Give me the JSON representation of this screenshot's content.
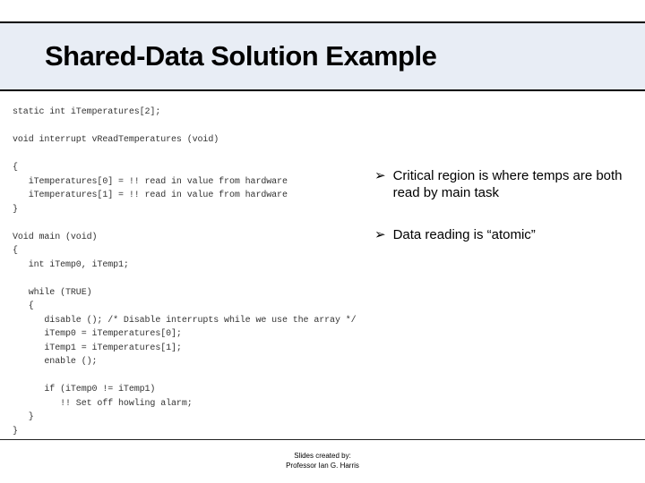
{
  "header": {
    "title": "Shared-Data Solution Example"
  },
  "code": {
    "lines": "static int iTemperatures[2];\n\nvoid interrupt vReadTemperatures (void)\n\n{\n   iTemperatures[0] = !! read in value from hardware\n   iTemperatures[1] = !! read in value from hardware\n}\n\nVoid main (void)\n{\n   int iTemp0, iTemp1;\n\n   while (TRUE)\n   {\n      disable (); /* Disable interrupts while we use the array */\n      iTemp0 = iTemperatures[0];\n      iTemp1 = iTemperatures[1];\n      enable ();\n\n      if (iTemp0 != iTemp1)\n         !! Set off howling alarm;\n   }\n}"
  },
  "bullets": {
    "items": [
      {
        "text": "Critical region is where temps are both read by main task"
      },
      {
        "text": "Data reading is “atomic”"
      }
    ],
    "marker": "➢"
  },
  "footer": {
    "line1": "Slides created by:",
    "line2": "Professor Ian G. Harris"
  }
}
